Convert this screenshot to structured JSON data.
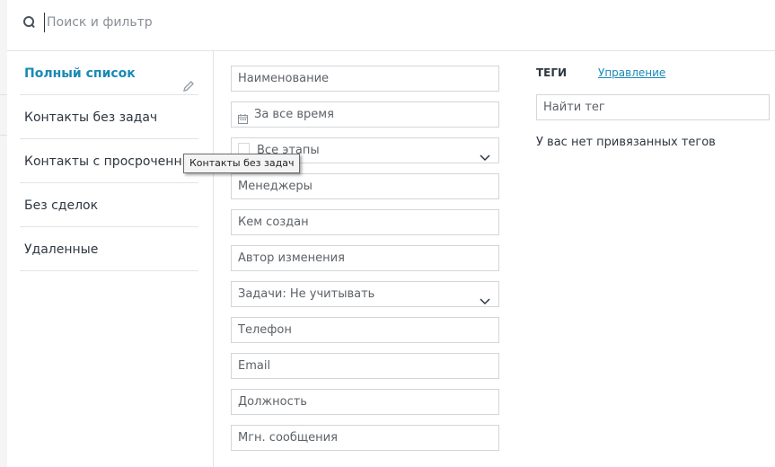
{
  "search": {
    "placeholder": "Поиск и фильтр"
  },
  "presets": [
    {
      "label": "Полный список"
    },
    {
      "label": "Контакты без задач"
    },
    {
      "label": "Контакты с просроченным..."
    },
    {
      "label": "Без сделок"
    },
    {
      "label": "Удаленные"
    }
  ],
  "tooltip": {
    "text": "Контакты без задач"
  },
  "filters": [
    {
      "label": "Наименование"
    },
    {
      "label": "За все время",
      "icon": "calendar-icon"
    },
    {
      "label": "Все этапы",
      "icon": "chevron-down-icon"
    },
    {
      "label": "Менеджеры"
    },
    {
      "label": "Кем создан"
    },
    {
      "label": "Автор изменения"
    },
    {
      "label": "Задачи: Не учитывать",
      "icon": "chevron-down-icon"
    },
    {
      "label": "Телефон"
    },
    {
      "label": "Email"
    },
    {
      "label": "Должность"
    },
    {
      "label": "Мгн. сообщения"
    }
  ],
  "tags": {
    "title": "ТЕГИ",
    "manage_label": "Управление",
    "search_placeholder": "Найти тег",
    "empty_text": "У вас нет привязанных тегов"
  },
  "colors": {
    "accent": "#1a8ab5",
    "border": "#d4d5d8",
    "text": "#2e3640"
  }
}
